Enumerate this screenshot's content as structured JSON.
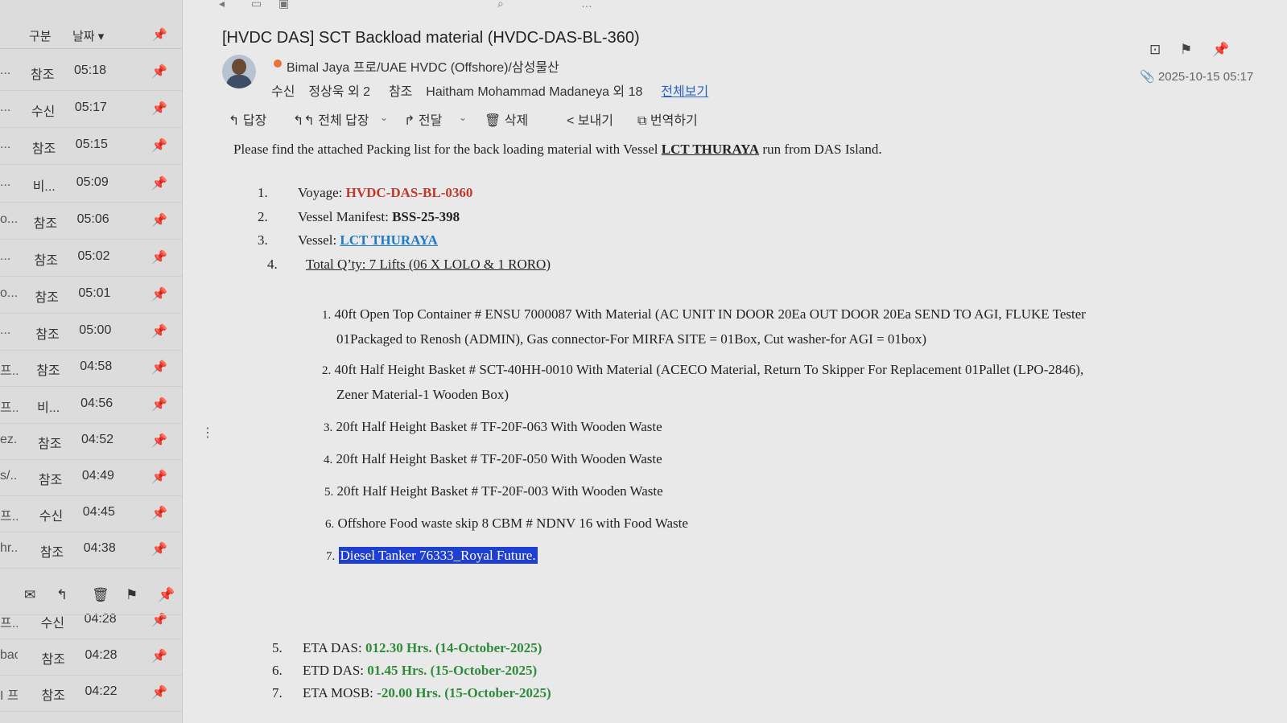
{
  "list": {
    "header": {
      "category": "구분",
      "date": "날짜 ▾"
    },
    "rows": [
      {
        "sender_stub": "...",
        "type": "참조",
        "time": "05:18"
      },
      {
        "sender_stub": "...",
        "type": "수신",
        "time": "05:17"
      },
      {
        "sender_stub": "...",
        "type": "참조",
        "time": "05:15"
      },
      {
        "sender_stub": "...",
        "type": "비...",
        "time": "05:09"
      },
      {
        "sender_stub": "o...",
        "type": "참조",
        "time": "05:06"
      },
      {
        "sender_stub": "...",
        "type": "참조",
        "time": "05:02"
      },
      {
        "sender_stub": "o...",
        "type": "참조",
        "time": "05:01"
      },
      {
        "sender_stub": "...",
        "type": "참조",
        "time": "05:00"
      },
      {
        "sender_stub": "프...",
        "type": "참조",
        "time": "04:58"
      },
      {
        "sender_stub": "프...",
        "type": "비...",
        "time": "04:56"
      },
      {
        "sender_stub": "ez...",
        "type": "참조",
        "time": "04:52"
      },
      {
        "sender_stub": "s/...",
        "type": "참조",
        "time": "04:49"
      },
      {
        "sender_stub": "프...",
        "type": "수신",
        "time": "04:45"
      },
      {
        "sender_stub": "hr...",
        "type": "참조",
        "time": "04:38"
      },
      {
        "sender_stub": "프...",
        "type": "수신",
        "time": "04:28"
      },
      {
        "sender_stub": "bao...",
        "type": "참조",
        "time": "04:28"
      },
      {
        "sender_stub": "I 프...",
        "type": "참조",
        "time": "04:22"
      }
    ],
    "row_tools": [
      "mail-icon",
      "reply-icon",
      "trash-icon",
      "flag-icon",
      "pin-icon"
    ]
  },
  "mail": {
    "subject": "[HVDC DAS] SCT Backload material (HVDC-DAS-BL-360)",
    "sender": "Bimal Jaya 프로/UAE HVDC (Offshore)/삼성물산",
    "to_label": "수신",
    "to": "정상욱 외 2",
    "cc_label": "참조",
    "cc": "Haitham Mohammad Madaneya 외 18",
    "view_all": "전체보기",
    "date": "2025-10-15 05:17",
    "actions": {
      "reply": "답장",
      "reply_all": "전체 답장",
      "forward": "전달",
      "delete": "삭제",
      "send": "보내기",
      "translate": "번역하기"
    }
  },
  "body": {
    "intro_pre": "Please find the attached Packing list for the back loading material with Vessel ",
    "intro_vessel": "LCT THURAYA",
    "intro_post": " run from DAS Island.",
    "items": [
      {
        "num": "1.",
        "label": "Voyage: ",
        "value": "HVDC-DAS-BL-0360"
      },
      {
        "num": "2.",
        "label": "Vessel Manifest: ",
        "value": "BSS-25-398"
      },
      {
        "num": "3.",
        "label": "Vessel: ",
        "value": "LCT THURAYA"
      },
      {
        "num": "4.",
        "label": "Total Q’ty: 7 Lifts (06 X LOLO & 1 RORO)"
      }
    ],
    "sub_items": [
      {
        "num": "1.",
        "text": "40ft Open Top Container # ENSU 7000087 With Material (AC UNIT IN DOOR 20Ea OUT DOOR 20Ea SEND TO AGI, FLUKE Tester",
        "text2": "01Packaged to Renosh (ADMIN), Gas connector-For MIRFA SITE = 01Box, Cut washer-for AGI = 01box)"
      },
      {
        "num": "2.",
        "text": "40ft Half Height Basket # SCT-40HH-0010 With Material (ACECO Material, Return To Skipper For Replacement 01Pallet (LPO-2846),",
        "text2": "Zener Material-1 Wooden Box)"
      },
      {
        "num": "3.",
        "text": "20ft Half Height Basket # TF-20F-063 With Wooden Waste"
      },
      {
        "num": "4.",
        "text": "20ft Half Height Basket # TF-20F-050 With Wooden Waste"
      },
      {
        "num": "5.",
        "text": "20ft Half Height Basket # TF-20F-003 With Wooden Waste"
      },
      {
        "num": "6.",
        "text": "Offshore Food waste skip 8 CBM # NDNV 16 with Food Waste"
      },
      {
        "num": "7.",
        "text": "Diesel Tanker 76333_Royal Future."
      }
    ],
    "schedule": [
      {
        "num": "5.",
        "label": "ETA DAS: ",
        "value": "012.30 Hrs. (14-October-2025)"
      },
      {
        "num": "6.",
        "label": "ETD DAS: ",
        "value": "01.45 Hrs. (15-October-2025)"
      },
      {
        "num": "7.",
        "label": "ETA MOSB: ",
        "value": "-20.00 Hrs. (15-October-2025)"
      }
    ]
  },
  "colors": {
    "voyage_red": "#c0392b",
    "link_blue": "#1f78c8",
    "eta_green": "#2e8b3a",
    "selection": "#1e3fd1"
  }
}
